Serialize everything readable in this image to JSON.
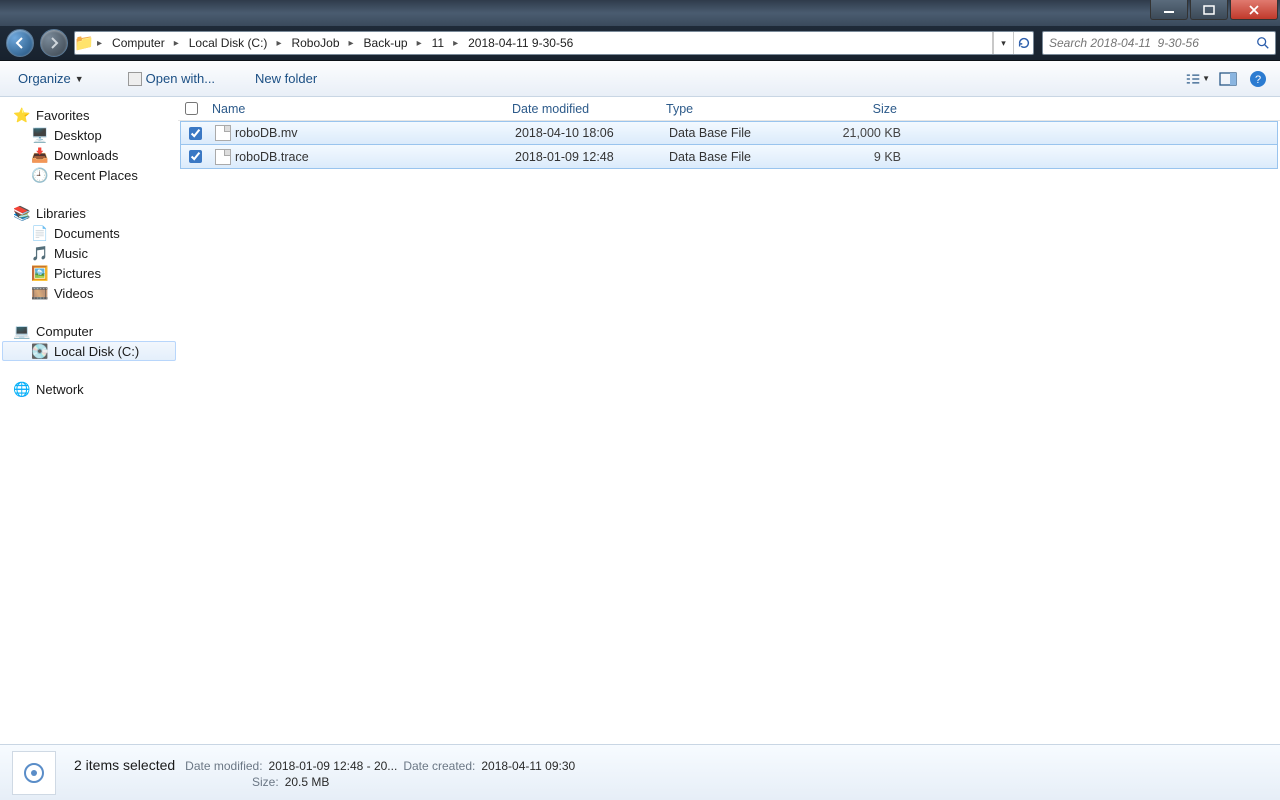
{
  "breadcrumbs": [
    "Computer",
    "Local Disk (C:)",
    "RoboJob",
    "Back-up",
    "11",
    "2018-04-11  9-30-56"
  ],
  "search_placeholder": "Search 2018-04-11  9-30-56",
  "toolbar": {
    "organize": "Organize",
    "open_with": "Open with...",
    "new_folder": "New folder"
  },
  "columns": {
    "name": "Name",
    "date": "Date modified",
    "type": "Type",
    "size": "Size"
  },
  "files": [
    {
      "name": "roboDB.mv",
      "date": "2018-04-10 18:06",
      "type": "Data Base File",
      "size": "21,000 KB"
    },
    {
      "name": "roboDB.trace",
      "date": "2018-01-09 12:48",
      "type": "Data Base File",
      "size": "9 KB"
    }
  ],
  "sidebar": {
    "favorites": {
      "label": "Favorites",
      "items": [
        "Desktop",
        "Downloads",
        "Recent Places"
      ]
    },
    "libraries": {
      "label": "Libraries",
      "items": [
        "Documents",
        "Music",
        "Pictures",
        "Videos"
      ]
    },
    "computer": {
      "label": "Computer",
      "items": [
        "Local Disk (C:)"
      ]
    },
    "network": {
      "label": "Network"
    }
  },
  "details": {
    "selection": "2 items selected",
    "date_modified_label": "Date modified:",
    "date_modified_value": "2018-01-09 12:48 - 20...",
    "date_created_label": "Date created:",
    "date_created_value": "2018-04-11 09:30",
    "size_label": "Size:",
    "size_value": "20.5 MB"
  }
}
